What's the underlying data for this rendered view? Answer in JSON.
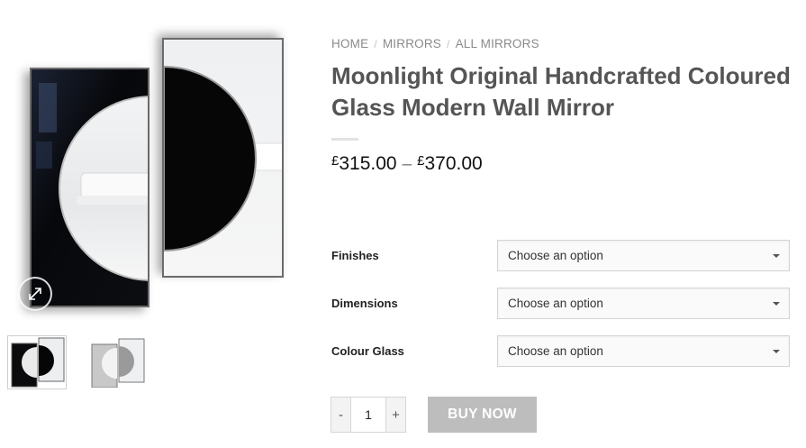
{
  "breadcrumb": {
    "items": [
      "HOME",
      "MIRRORS",
      "ALL MIRRORS"
    ],
    "separator": "/"
  },
  "product": {
    "title": "Moonlight Original Handcrafted Coloured Glass Modern Wall Mirror",
    "price": {
      "currency": "£",
      "min": "315.00",
      "dash": "–",
      "max": "370.00"
    }
  },
  "variations": [
    {
      "label": "Finishes",
      "value": "Choose an option"
    },
    {
      "label": "Dimensions",
      "value": "Choose an option"
    },
    {
      "label": "Colour Glass",
      "value": "Choose an option"
    }
  ],
  "quantity": {
    "minus": "-",
    "value": "1",
    "plus": "+"
  },
  "buy_button": {
    "label": "BUY NOW"
  },
  "gallery": {
    "zoom_icon": "expand-arrows-icon",
    "thumbnails": [
      "black-glass-variant",
      "grey-glass-variant"
    ]
  },
  "colors": {
    "buy_button_bg": "#bdbdbd",
    "title": "#555555",
    "breadcrumb": "#8a8a8a"
  }
}
